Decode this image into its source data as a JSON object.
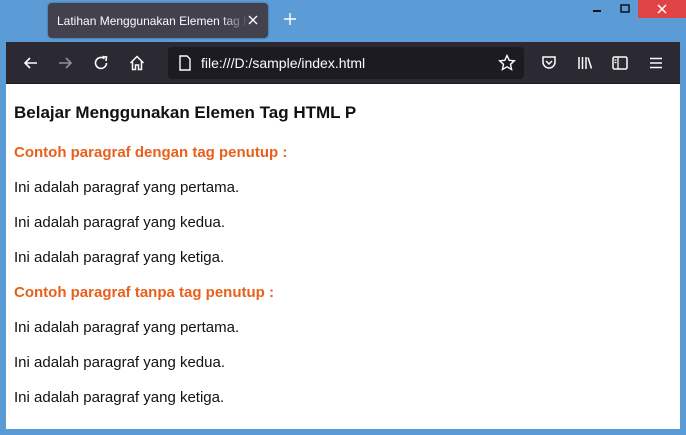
{
  "browser": {
    "tab_title": "Latihan Menggunakan Elemen tag HTML P",
    "url": "file:///D:/sample/index.html",
    "icons": [
      "back-icon",
      "forward-icon",
      "reload-icon",
      "home-icon",
      "page-icon",
      "bookmark-star-icon",
      "pocket-icon",
      "library-icon",
      "sidebar-icon",
      "menu-icon"
    ]
  },
  "page": {
    "heading": "Belajar Menggunakan Elemen Tag HTML P",
    "section1": {
      "title": "Contoh paragraf dengan tag penutup :",
      "paragraphs": [
        "Ini adalah paragraf yang pertama.",
        "Ini adalah paragraf yang kedua.",
        "Ini adalah paragraf yang ketiga."
      ]
    },
    "section2": {
      "title": "Contoh paragraf tanpa tag penutup :",
      "paragraphs": [
        "Ini adalah paragraf yang pertama.",
        "Ini adalah paragraf yang kedua.",
        "Ini adalah paragraf yang ketiga."
      ]
    }
  },
  "colors": {
    "accent": "#e8601c",
    "titlebar": "#5c9cd6",
    "toolbar": "#2b2a33",
    "close": "#e04343"
  }
}
